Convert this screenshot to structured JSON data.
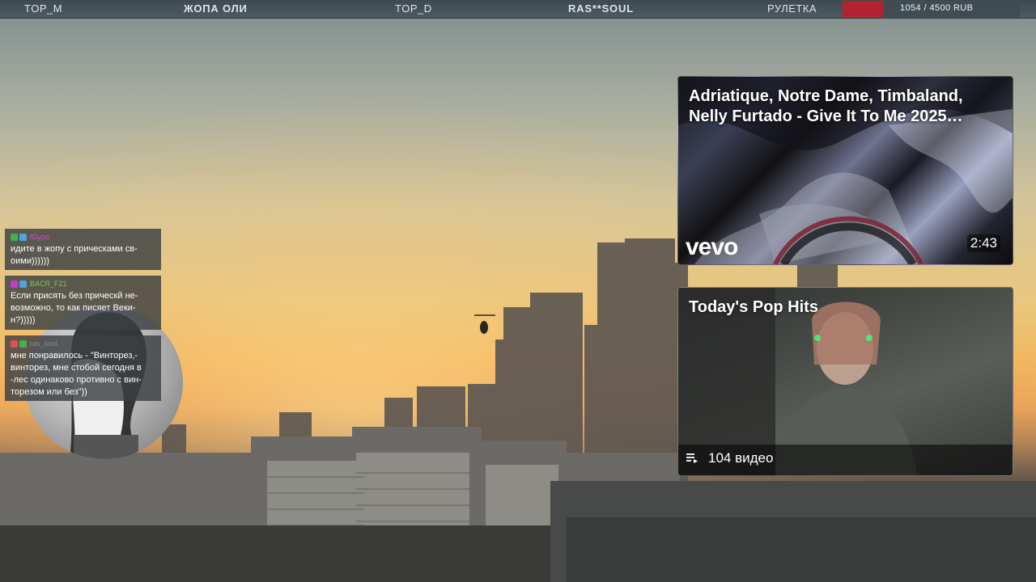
{
  "topbar": {
    "top_m": "TOP_M",
    "zhopa_oli": "ЖОПА ОЛИ",
    "top_d": "TOP_D",
    "ras_soul": "RAS**SOUL",
    "roulette": "РУЛЕТКА",
    "goal_text": "1054 / 4500 RUB",
    "goal_progress": 0.234,
    "goal_color": "#b3232f"
  },
  "video_card": {
    "title": "Adriatique, Notre Dame, Timbaland, Nelly Furtado - Give It To Me 2025…",
    "duration": "2:43",
    "channel_logo": "vevo"
  },
  "playlist_card": {
    "title": "Today's Pop Hits",
    "count": "104 видео",
    "icon": "playlist-icon"
  },
  "chat": {
    "messages": [
      {
        "user": "tGypo",
        "user_color": "#d946c9",
        "badges": [
          "#3fb24f",
          "#4fa3e0"
        ],
        "text": "идите в жопу с прическами св-оими))))))"
      },
      {
        "user": "BACR_F21",
        "user_color": "#6fd13b",
        "badges": [
          "#c43bd0",
          "#4fa3e0"
        ],
        "text": "Если присять без прическй не-возможно, то как писяет Веки-н?)))))"
      },
      {
        "user": "ras_soul",
        "user_color": "#888888",
        "badges": [
          "#e05050",
          "#3fb24f"
        ],
        "text": "мне понравилось - \"Винторез,-винторез, мне стобой сегодня в -лес одинаково противно с вин-торезом или без\"))"
      }
    ]
  }
}
